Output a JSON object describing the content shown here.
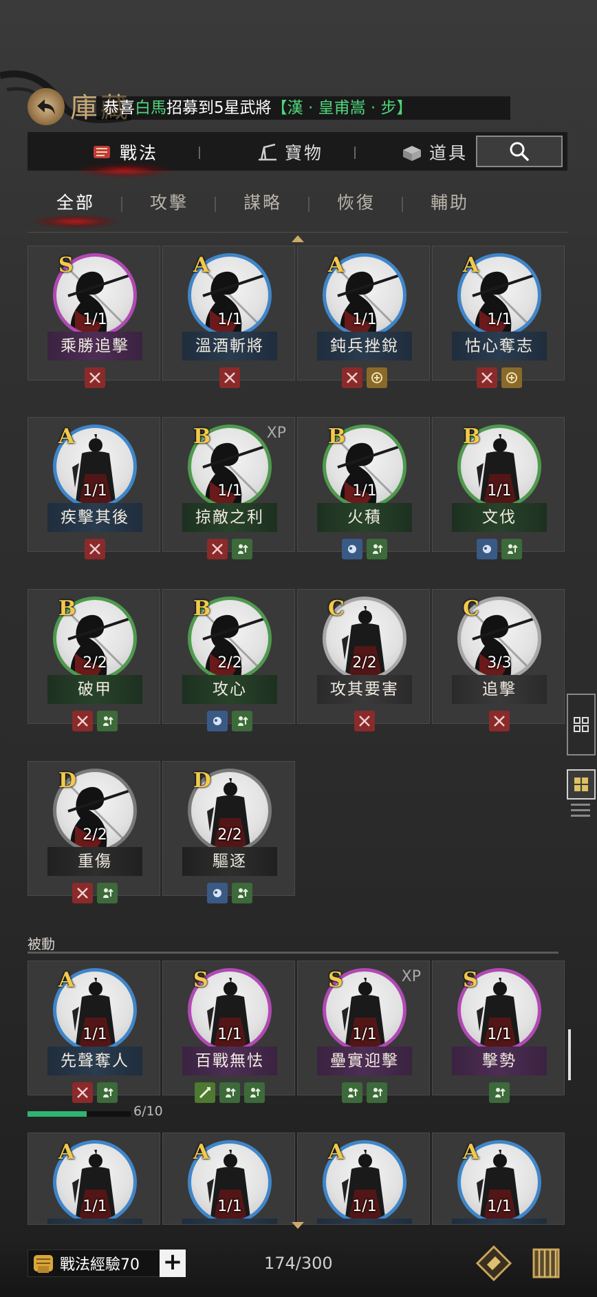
{
  "header": {
    "title": "庫藏",
    "announcement": {
      "prefix": "恭喜",
      "player": "白馬",
      "middle": "招募到5星武將",
      "general": "【漢 · 皇甫嵩 · 步】"
    }
  },
  "main_tabs": [
    {
      "label": "戰法",
      "icon": "tactic-scroll-icon",
      "active": true
    },
    {
      "label": "寶物",
      "icon": "treasure-icon",
      "active": false
    },
    {
      "label": "道具",
      "icon": "item-box-icon",
      "active": false
    }
  ],
  "search": {
    "icon": "search-icon"
  },
  "sub_tabs": [
    {
      "label": "全部",
      "active": true
    },
    {
      "label": "攻擊",
      "active": false
    },
    {
      "label": "謀略",
      "active": false
    },
    {
      "label": "恢復",
      "active": false
    },
    {
      "label": "輔助",
      "active": false
    }
  ],
  "active_cards": [
    {
      "grade": "S",
      "name": "乘勝追擊",
      "count": "1/1",
      "xp": "",
      "tags": [
        "attack"
      ]
    },
    {
      "grade": "A",
      "name": "溫酒斬將",
      "count": "1/1",
      "xp": "",
      "tags": [
        "attack"
      ]
    },
    {
      "grade": "A",
      "name": "鈍兵挫銳",
      "count": "1/1",
      "xp": "",
      "tags": [
        "attack",
        "gold"
      ]
    },
    {
      "grade": "A",
      "name": "怙心奪志",
      "count": "1/1",
      "xp": "",
      "tags": [
        "attack",
        "gold"
      ]
    },
    {
      "grade": "A",
      "name": "疾擊其後",
      "count": "1/1",
      "xp": "",
      "tags": [
        "attack"
      ]
    },
    {
      "grade": "B",
      "name": "掠敵之利",
      "count": "1/1",
      "xp": "XP",
      "tags": [
        "attack",
        "buff"
      ]
    },
    {
      "grade": "B",
      "name": "火積",
      "count": "1/1",
      "xp": "",
      "tags": [
        "blue",
        "buff"
      ]
    },
    {
      "grade": "B",
      "name": "文伐",
      "count": "1/1",
      "xp": "",
      "tags": [
        "blue",
        "buff"
      ]
    },
    {
      "grade": "B",
      "name": "破甲",
      "count": "2/2",
      "xp": "",
      "tags": [
        "attack",
        "buff"
      ]
    },
    {
      "grade": "B",
      "name": "攻心",
      "count": "2/2",
      "xp": "",
      "tags": [
        "blue",
        "buff"
      ]
    },
    {
      "grade": "C",
      "name": "攻其要害",
      "count": "2/2",
      "xp": "",
      "tags": [
        "attack"
      ]
    },
    {
      "grade": "C",
      "name": "追擊",
      "count": "3/3",
      "xp": "",
      "tags": [
        "attack"
      ]
    },
    {
      "grade": "D",
      "name": "重傷",
      "count": "2/2",
      "xp": "",
      "tags": [
        "attack",
        "buff"
      ]
    },
    {
      "grade": "D",
      "name": "驅逐",
      "count": "2/2",
      "xp": "",
      "tags": [
        "blue",
        "buff"
      ]
    }
  ],
  "passive_section": {
    "label": "被動"
  },
  "passive_cards": [
    {
      "grade": "A",
      "name": "先聲奪人",
      "count": "1/1",
      "xp": "",
      "tags": [
        "attack",
        "buff"
      ]
    },
    {
      "grade": "S",
      "name": "百戰無怯",
      "count": "1/1",
      "xp": "",
      "tags": [
        "green2",
        "buff",
        "buff"
      ]
    },
    {
      "grade": "S",
      "name": "壘實迎擊",
      "count": "1/1",
      "xp": "XP",
      "tags": [
        "buff",
        "buff"
      ]
    },
    {
      "grade": "S",
      "name": "擊勢",
      "count": "1/1",
      "xp": "",
      "tags": [
        "buff"
      ]
    },
    {
      "grade": "A",
      "name": "",
      "count": "1/1",
      "xp": "",
      "tags": []
    },
    {
      "grade": "A",
      "name": "",
      "count": "1/1",
      "xp": "",
      "tags": []
    },
    {
      "grade": "A",
      "name": "",
      "count": "1/1",
      "xp": "",
      "tags": []
    },
    {
      "grade": "A",
      "name": "",
      "count": "1/1",
      "xp": "",
      "tags": []
    }
  ],
  "passive_progress": {
    "text": "6/10",
    "fraction": 0.6
  },
  "bottom": {
    "exp_label": "戰法經驗70",
    "plus": "+",
    "capacity": "174/300"
  },
  "colors": {
    "grade_S": "#b04ab3",
    "grade_A": "#3f86c9",
    "grade_B": "#4f9a4e",
    "grade_C": "#a8a8a8",
    "grade_D": "#7a7a7a",
    "accent_red": "#c81414",
    "grade_letter": "#f2c94c",
    "progress": "#2fb573"
  }
}
